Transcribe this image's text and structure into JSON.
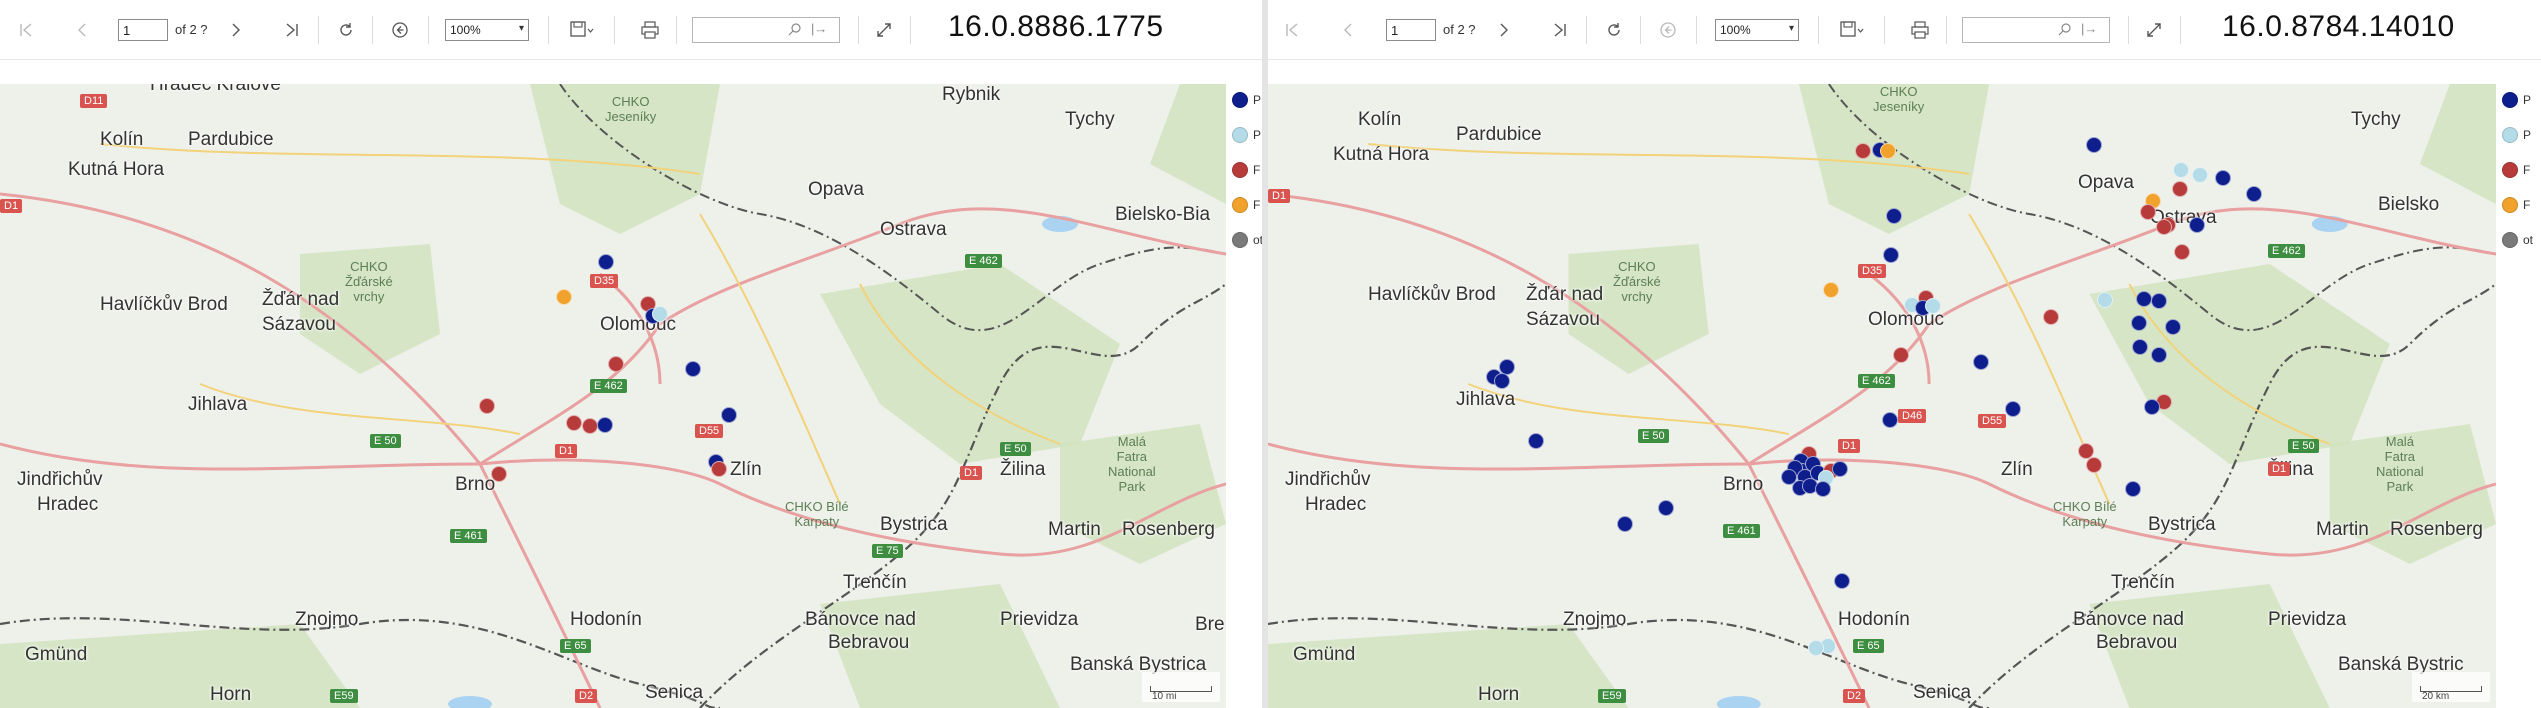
{
  "colors": {
    "dark_blue": "#0e1e8c",
    "light_blue": "#b3dbe8",
    "red": "#b83b3b",
    "orange": "#f0a22c",
    "gray": "#7a7a7a",
    "map_bg": "#eef0ea",
    "forest": "#cfe2bd",
    "border": "#555555"
  },
  "left": {
    "toolbar": {
      "first_page_icon": "first-page-icon",
      "prev_page_icon": "prev-page-icon",
      "page_value": "1",
      "page_of": "of 2 ?",
      "next_page_icon": "next-page-icon",
      "last_page_icon": "last-page-icon",
      "refresh_icon": "refresh-icon",
      "back_icon": "back-icon",
      "zoom_value": "100%",
      "save_icon": "save-icon",
      "print_icon": "print-icon",
      "search_placeholder": "",
      "find_next_label": "|→",
      "fullscreen_icon": "expand-icon",
      "version": "16.0.8886.1775"
    },
    "legend": [
      "P",
      "P",
      "F",
      "F",
      "ot"
    ]
  },
  "right": {
    "toolbar": {
      "page_value": "1",
      "page_of": "of 2 ?",
      "zoom_value": "100%",
      "search_placeholder": "",
      "find_next_label": "|→",
      "version": "16.0.8784.14010"
    },
    "legend": [
      "P",
      "P",
      "F",
      "F",
      "ot"
    ]
  },
  "map_labels": {
    "left": {
      "cities": [
        "Hradec Králové",
        "Kolín",
        "Kutná Hora",
        "Pardubice",
        "Opava",
        "Ostrava",
        "Tychy",
        "Bielsko-Bia",
        "Havlíčkův Brod",
        "Žďár nad",
        "Sázavou",
        "Jihlava",
        "Olomouc",
        "Zlín",
        "Jindřichův",
        "Hradec",
        "Brno",
        "Žilina",
        "Bystrica",
        "Martin",
        "Rosenberg",
        "Trenčín",
        "Znojmo",
        "Hodonín",
        "Bánovce nad",
        "Bebravou",
        "Prievidza",
        "Gmünd",
        "Horn",
        "Senica",
        "Banská Bystrica",
        "Bre",
        "Rybnik"
      ],
      "parks": [
        "CHKO\nJeseníky",
        "CHKO\nŽďárské\nvrchy",
        "CHKO Bílé\nKarpaty",
        "Malá\nFatra\nNational\nPark"
      ],
      "roads": [
        "D11",
        "D1",
        "D35",
        "E 462",
        "E 50",
        "D1",
        "D55",
        "E 462",
        "E 50",
        "D1",
        "E 461",
        "E 75",
        "E 65",
        "D2",
        "E59"
      ],
      "scale": "10 mi"
    },
    "right": {
      "cities": [
        "Kolín",
        "Kutná Hora",
        "Pardubice",
        "Opava",
        "Ostrava",
        "Tychy",
        "Bielsko",
        "Havlíčkův Brod",
        "Žďár nad",
        "Sázavou",
        "Jihlava",
        "Olomouc",
        "Zlín",
        "Jindřichův",
        "Hradec",
        "Brno",
        "Žilina",
        "Bystrica",
        "Martin",
        "Rosenberg",
        "Trenčín",
        "Znojmo",
        "Hodonín",
        "Bánovce nad",
        "Bebravou",
        "Prievidza",
        "Gmünd",
        "Horn",
        "Senica",
        "Banská Bystric"
      ],
      "parks": [
        "CHKO\nJeseníky",
        "CHKO\nŽďárské\nvrchy",
        "CHKO Bílé\nKarpaty",
        "Malá\nFatra\nNational\nPark"
      ],
      "roads": [
        "D1",
        "D35",
        "E 462",
        "E 462",
        "E 50",
        "D1",
        "D46",
        "D55",
        "E 461",
        "E 65",
        "D2",
        "E59",
        "E 50",
        "D1"
      ],
      "scale": "20 km"
    }
  }
}
